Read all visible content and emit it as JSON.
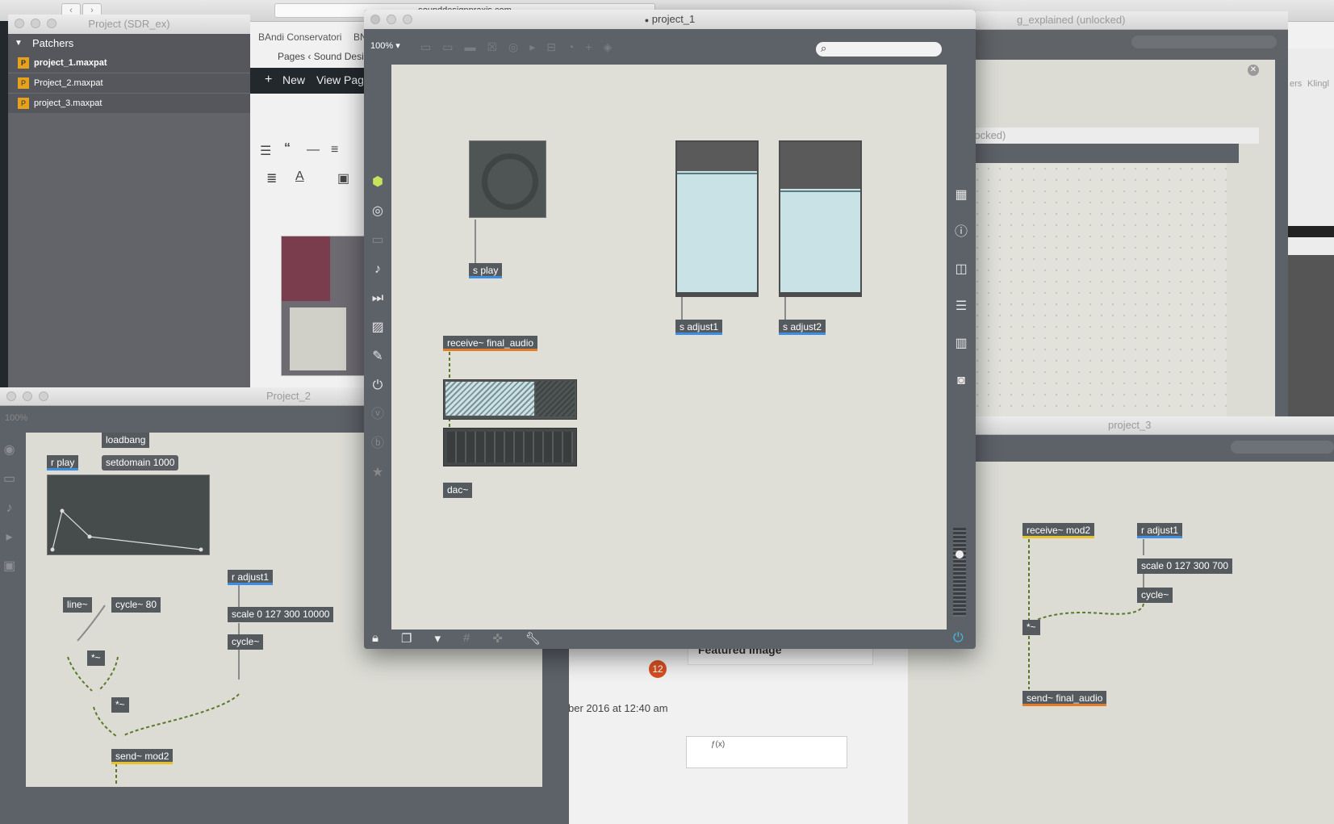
{
  "browser": {
    "url_fragment": "sounddesignpraxis.com",
    "bookmarks": [
      "BAndi Conservatori",
      "BN"
    ],
    "breadcrumb": "Pages ‹ Sound Desi",
    "admin_new": "New",
    "admin_view": "View Pag",
    "featured_image": "Featured Image",
    "notification_count": "12",
    "date_text": "ber 2016 at 12:40 am"
  },
  "project_window": {
    "title": "Project (SDR_ex)",
    "section": "Patchers",
    "files": [
      "project_1.maxpat",
      "Project_2.maxpat",
      "project_3.maxpat"
    ]
  },
  "project_1": {
    "title": "project_1",
    "zoom": "100%",
    "objects": {
      "s_play": "s play",
      "s_adjust1": "s adjust1",
      "s_adjust2": "s adjust2",
      "receive_final": "receive~ final_audio",
      "dac": "dac~"
    }
  },
  "project_2": {
    "title": "Project_2",
    "zoom": "100%",
    "objects": {
      "loadbang": "loadbang",
      "r_play": "r play",
      "setdomain": "setdomain 1000",
      "line": "line~",
      "cycle80": "cycle~ 80",
      "r_adjust1": "r adjust1",
      "scale": "scale 0 127 300 10000",
      "cycle": "cycle~",
      "mul1": "*~",
      "mul2": "*~",
      "send_mod2": "send~ mod2"
    }
  },
  "project_3": {
    "title": "project_3",
    "objects": {
      "receive_mod2": "receive~ mod2",
      "r_adjust1": "r adjust1",
      "scale": "scale 0 127 300 700",
      "cycle": "cycle~",
      "mul": "*~",
      "send_final": "send~ final_audio"
    }
  },
  "background_window": {
    "title": "g_explained (unlocked)",
    "subtitle": "unlocked)",
    "tabs": [
      "ers",
      "Klingl"
    ]
  }
}
